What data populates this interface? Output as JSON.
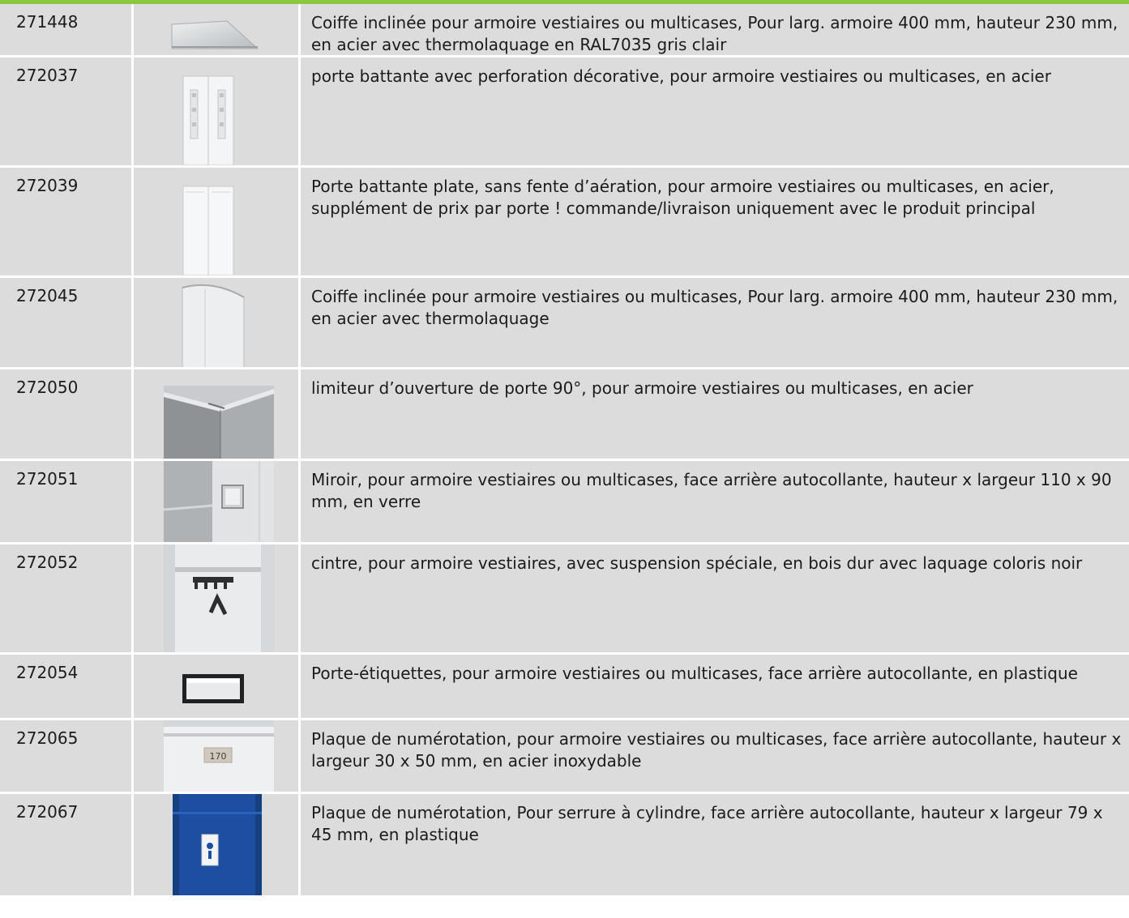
{
  "accent_color": "#8dc63f",
  "rows": [
    {
      "code": "271448",
      "image": "sloped-cap-icon",
      "description": "Coiffe inclinée pour armoire vestiaires ou multicases, Pour larg. armoire 400 mm, hauteur 230 mm, en acier avec thermolaquage en RAL7035 gris clair"
    },
    {
      "code": "272037",
      "image": "perforated-door-icon",
      "description": "porte battante avec perforation décorative, pour armoire vestiaires ou multicases, en acier"
    },
    {
      "code": "272039",
      "image": "flat-door-icon",
      "description": "Porte battante plate, sans fente d’aération, pour armoire vestiaires ou multicases, en acier, supplément de prix par porte ! commande/livraison uniquement avec le produit principal"
    },
    {
      "code": "272045",
      "image": "sloped-cap-side-icon",
      "description": "Coiffe inclinée pour armoire vestiaires ou multicases, Pour larg. armoire 400 mm, hauteur 230 mm, en acier avec thermolaquage"
    },
    {
      "code": "272050",
      "image": "door-limiter-icon",
      "description": "limiteur d’ouverture de porte 90°, pour armoire vestiaires ou multicases, en acier"
    },
    {
      "code": "272051",
      "image": "mirror-icon",
      "description": "Miroir, pour armoire vestiaires ou multicases, face arrière autocollante, hauteur x largeur 110 x 90 mm, en verre"
    },
    {
      "code": "272052",
      "image": "hanger-icon",
      "description": "cintre, pour armoire vestiaires, avec suspension spéciale, en bois dur avec laquage coloris noir"
    },
    {
      "code": "272054",
      "image": "label-holder-icon",
      "description": "Porte-étiquettes, pour armoire vestiaires ou multicases, face arrière autocollante, en plastique"
    },
    {
      "code": "272065",
      "image": "number-plate-icon",
      "image_text": "170",
      "description": "Plaque de numérotation, pour armoire vestiaires ou multicases, face arrière autocollante, hauteur x largeur 30 x 50 mm, en acier inoxydable"
    },
    {
      "code": "272067",
      "image": "cylinder-lock-plate-icon",
      "description": "Plaque de numérotation, Pour serrure à cylindre, face arrière autocollante, hauteur x largeur 79 x 45 mm, en plastique"
    }
  ]
}
